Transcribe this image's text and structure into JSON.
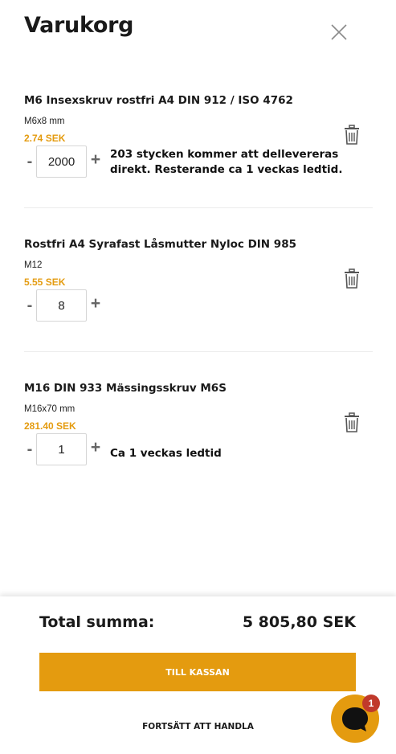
{
  "header": {
    "title": "Varukorg"
  },
  "items": [
    {
      "name": "M6 Insexskruv rostfri A4 DIN 912 / ISO 4762",
      "variant": "M6x8 mm",
      "price": "2.74 SEK",
      "quantity": "2000",
      "note": "203 stycken kommer att dellevereras direkt. Resterande ca 1 veckas ledtid."
    },
    {
      "name": "Rostfri A4 Syrafast Låsmutter Nyloc DIN 985",
      "variant": "M12",
      "price": "5.55 SEK",
      "quantity": "8",
      "note": ""
    },
    {
      "name": "M16 DIN 933 Mässingsskruv M6S",
      "variant": "M16x70 mm",
      "price": "281.40 SEK",
      "quantity": "1",
      "note": "Ca 1 veckas ledtid"
    }
  ],
  "qty_controls": {
    "minus": "-",
    "plus": "+"
  },
  "footer": {
    "total_label": "Total summa:",
    "total_value": "5 805,80 SEK",
    "checkout_label": "TILL KASSAN",
    "continue_label": "FORTSÄTT ATT HANDLA"
  },
  "chat": {
    "badge_count": "1"
  },
  "colors": {
    "accent": "#e49b0f",
    "badge": "#c0392b",
    "text": "#1a1a1a"
  },
  "icons": {
    "close": "close-icon",
    "trash": "trash-icon",
    "chat": "chat-bubble-icon"
  }
}
